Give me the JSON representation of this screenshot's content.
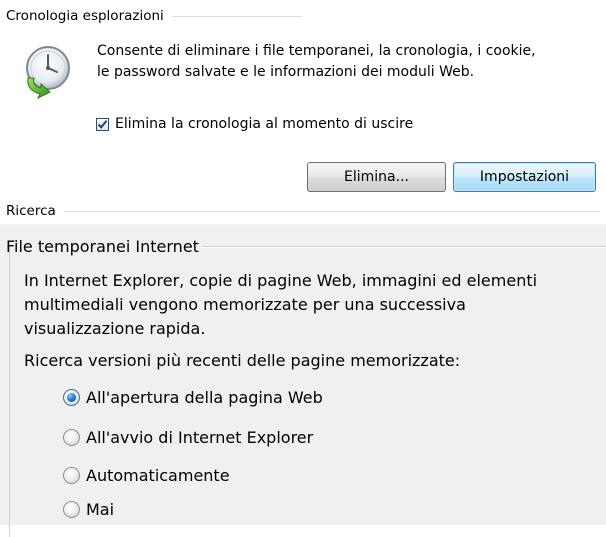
{
  "browsing_history": {
    "section_title": "Cronologia esplorazioni",
    "icon": "history-clock-icon",
    "description_line1": "Consente di eliminare i file temporanei, la cronologia, i cookie,",
    "description_line2": "le password salvate e le informazioni dei moduli Web.",
    "delete_on_exit_label": "Elimina la cronologia al momento di uscire",
    "delete_on_exit_checked": true,
    "delete_button_label": "Elimina...",
    "settings_button_label": "Impostazioni"
  },
  "search": {
    "section_title": "Ricerca"
  },
  "temporary_files_dialog": {
    "group_title": "File temporanei Internet",
    "description_line1": "In Internet Explorer, copie di pagine Web, immagini ed elementi",
    "description_line2": "multimediali vengono memorizzate per una successiva",
    "description_line3": "visualizzazione rapida.",
    "question": "Ricerca versioni più recenti delle pagine memorizzate:",
    "options": [
      {
        "label": "All'apertura della pagina Web",
        "selected": true
      },
      {
        "label": "All'avvio di Internet Explorer",
        "selected": false
      },
      {
        "label": "Automaticamente",
        "selected": false
      },
      {
        "label": "Mai",
        "selected": false
      }
    ]
  },
  "colors": {
    "accent": "#1c5180",
    "dialog_background": "#f0f0f0",
    "settings_button_border": "#3c7fb1"
  }
}
